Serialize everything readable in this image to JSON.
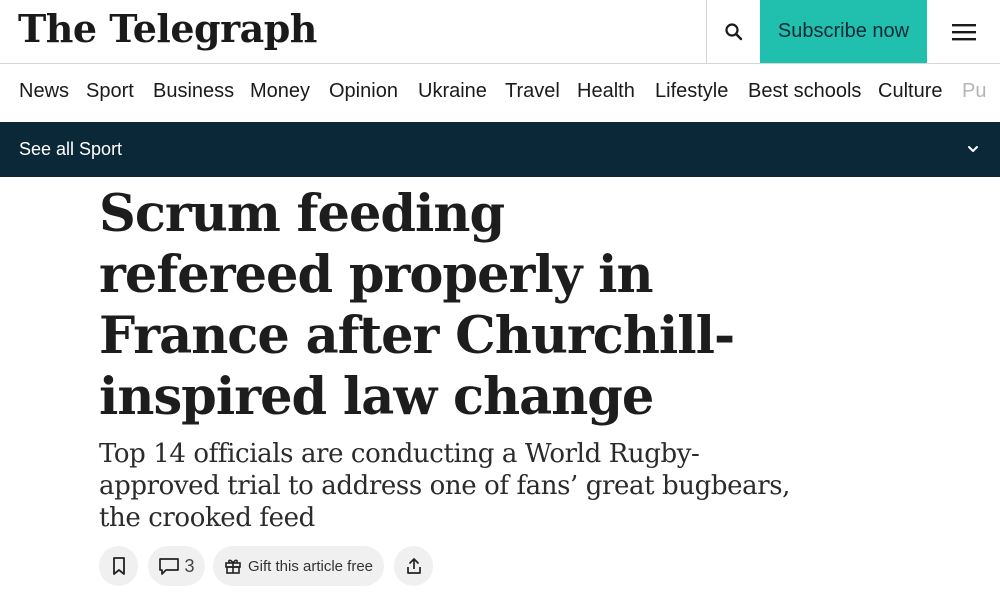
{
  "header": {
    "logo_text": "The Telegraph",
    "subscribe_label": "Subscribe now",
    "search_icon": "search-icon",
    "menu_icon": "hamburger-menu-icon",
    "accent_color": "#21bfae"
  },
  "nav": {
    "items": [
      "News",
      "Sport",
      "Business",
      "Money",
      "Opinion",
      "Ukraine",
      "Travel",
      "Health",
      "Lifestyle",
      "Best schools",
      "Culture",
      "Pu"
    ]
  },
  "section_bar": {
    "label": "See all Sport",
    "chevron_icon": "chevron-down-icon",
    "background": "#0b2838"
  },
  "article": {
    "headline": "Scrum feeding refereed properly in France after Churchill-inspired law change",
    "standfirst": "Top 14 officials are conducting a World Rugby-approved trial to address one of fans’ great bugbears, the crooked feed"
  },
  "actions": {
    "bookmark_icon": "bookmark-icon",
    "comment_icon": "comment-icon",
    "comment_count": "3",
    "gift_icon": "gift-icon",
    "gift_label": "Gift this article free",
    "share_icon": "share-icon"
  }
}
